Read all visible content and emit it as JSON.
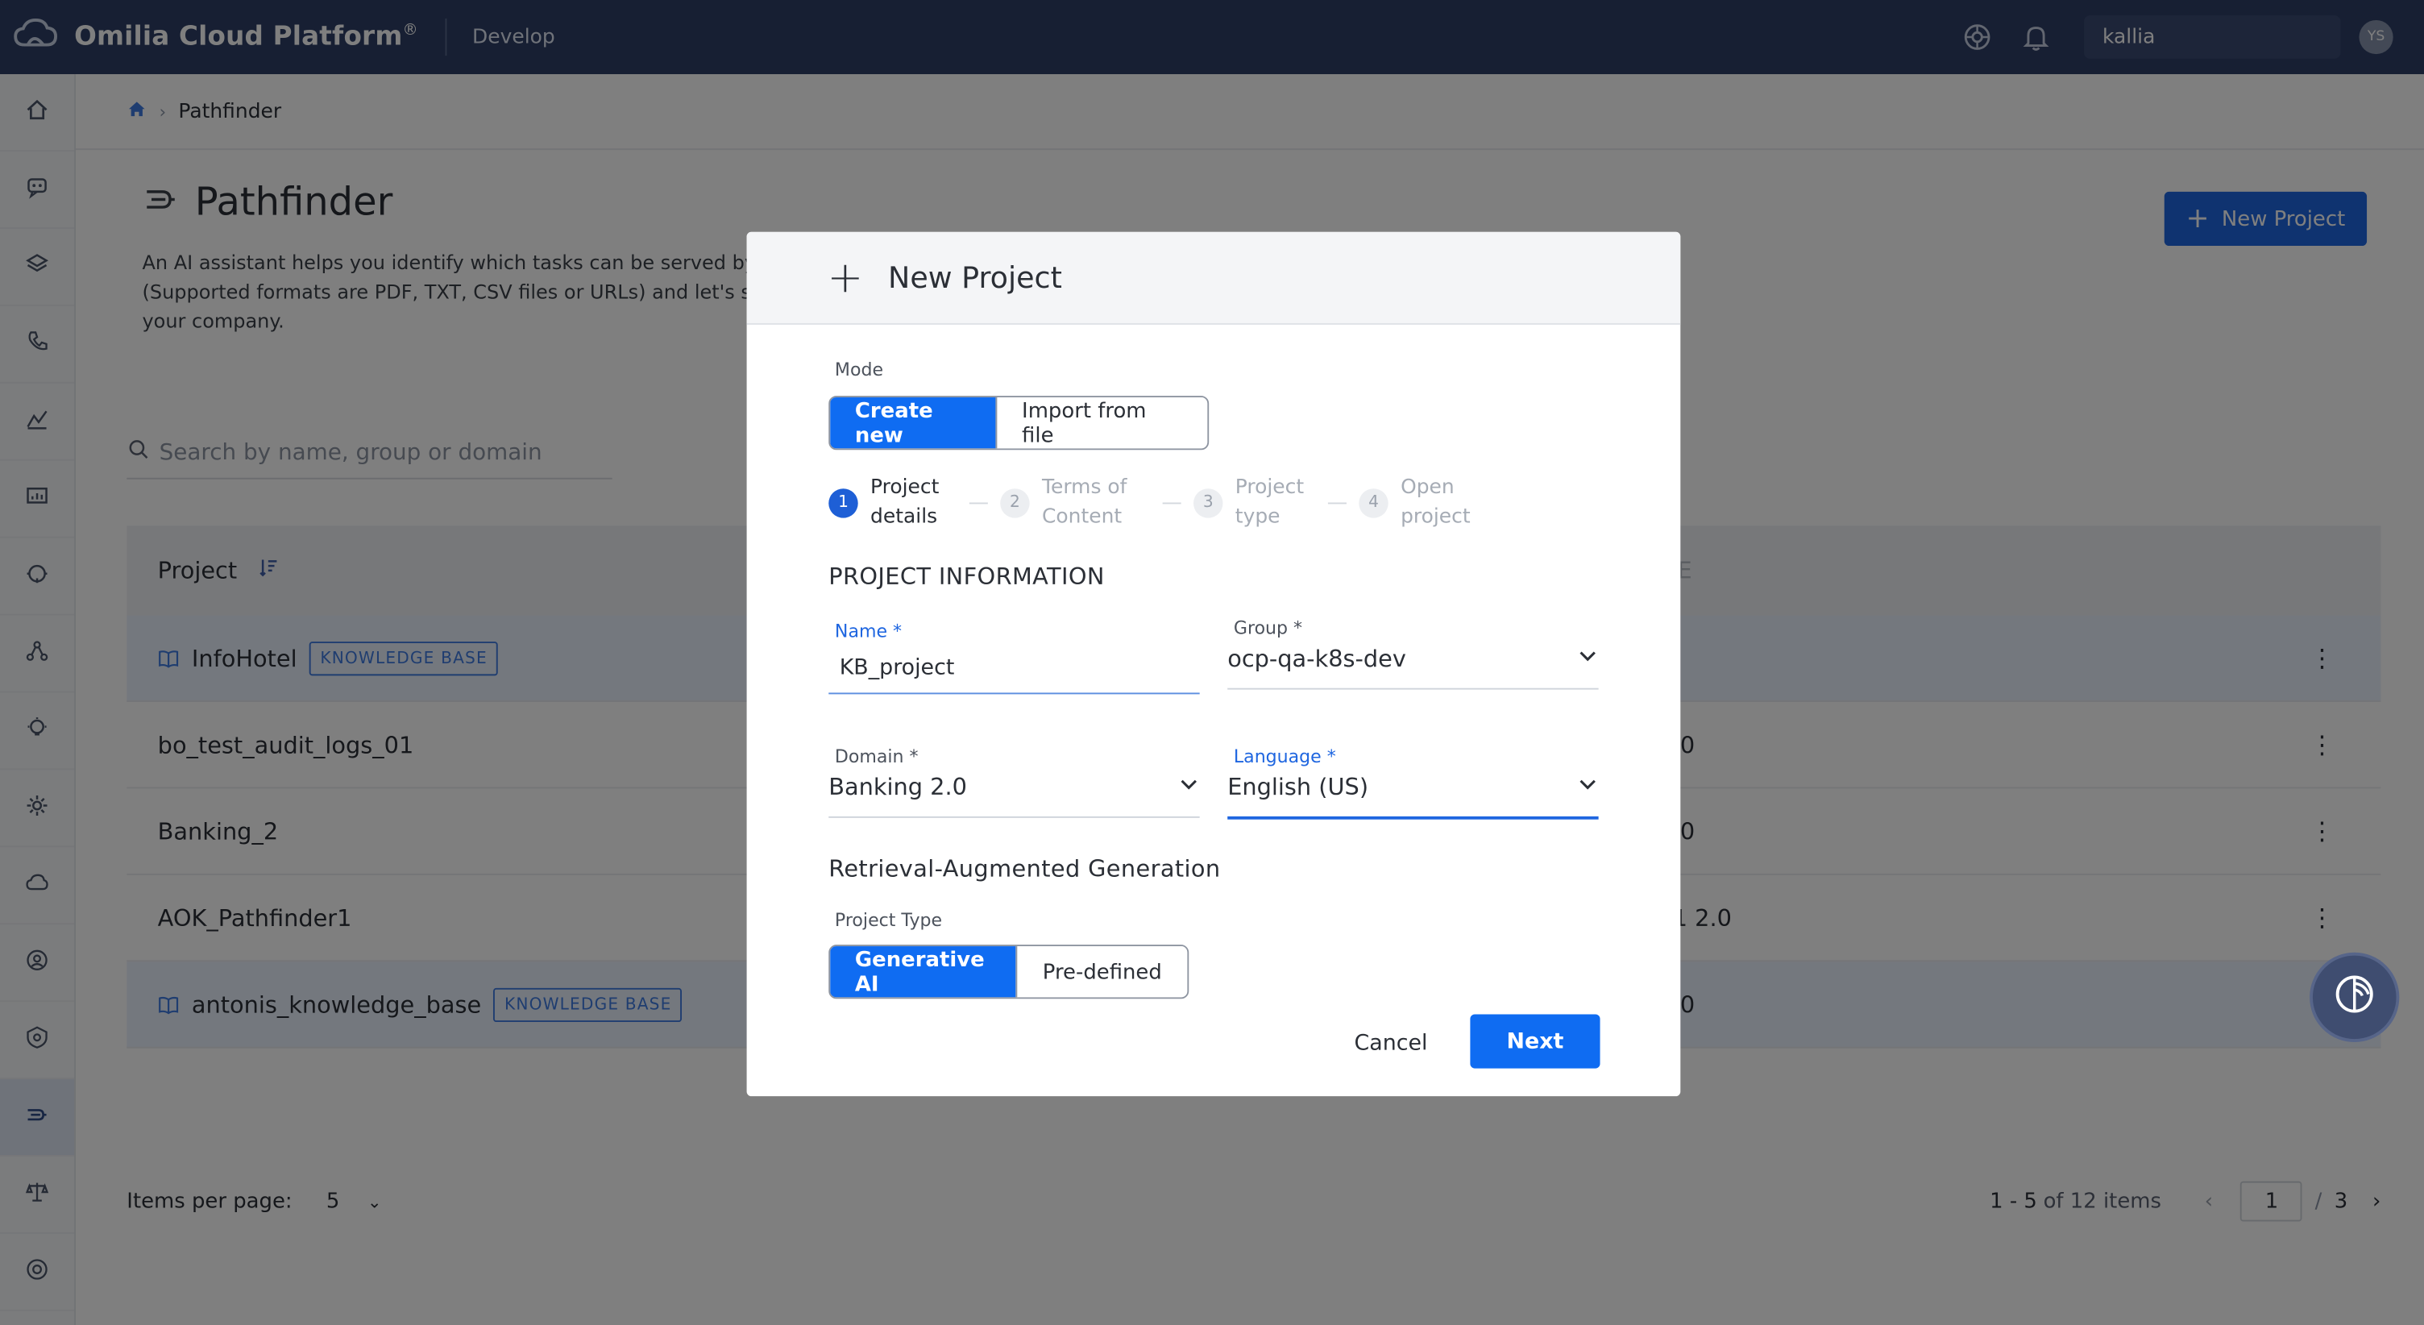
{
  "topbar": {
    "brand": "Omilia Cloud Platform",
    "brand_mark": "®",
    "environment": "Develop",
    "tenant": "kallia",
    "avatar_initials": "YS"
  },
  "sidebar": {
    "items": [
      "home-icon",
      "bots-icon",
      "layers-icon",
      "phone-icon",
      "analytics-icon",
      "monitor-icon",
      "support-icon",
      "network-icon",
      "insights-icon",
      "settings-icon",
      "cloud-icon",
      "users-icon",
      "admin-icon",
      "pathfinder-icon",
      "balance-icon",
      "help-icon"
    ],
    "active_index": 13
  },
  "breadcrumb": {
    "current": "Pathfinder"
  },
  "page": {
    "title": "Pathfinder",
    "description": "An AI assistant helps you identify which tasks can be served by\n(Supported formats are PDF, TXT, CSV files or URLs) and let's se\nyour company.",
    "new_project_label": "New Project",
    "search_placeholder": "Search by name, group or domain"
  },
  "table": {
    "header_project": "Project",
    "header_partial": "E",
    "rows": [
      {
        "name": "InfoHotel",
        "badge": "KNOWLEDGE BASE",
        "right": "-",
        "kb": true
      },
      {
        "name": "bo_test_audit_logs_01",
        "badge": "",
        "right": ".0",
        "kb": false
      },
      {
        "name": "Banking_2",
        "badge": "",
        "right": ".0",
        "kb": false
      },
      {
        "name": "AOK_Pathfinder1",
        "badge": "",
        "right": "1 2.0",
        "kb": false
      },
      {
        "name": "antonis_knowledge_base",
        "badge": "KNOWLEDGE BASE",
        "right": ".0",
        "kb": true
      }
    ]
  },
  "pager": {
    "items_per_page_label": "Items per page:",
    "items_per_page": "5",
    "range": "1 - 5",
    "of_items": "of 12 items",
    "current_page": "1",
    "total_pages": "3",
    "separator": "/"
  },
  "modal": {
    "title": "New Project",
    "mode_label": "Mode",
    "mode_options": [
      "Create new",
      "Import from file"
    ],
    "mode_selected": "Create new",
    "steps": [
      {
        "num": "1",
        "label": "Project details",
        "active": true
      },
      {
        "num": "2",
        "label": "Terms of Content",
        "active": false
      },
      {
        "num": "3",
        "label": "Project type",
        "active": false
      },
      {
        "num": "4",
        "label": "Open project",
        "active": false
      }
    ],
    "section_info": "PROJECT INFORMATION",
    "name_label": "Name *",
    "name_value": "KB_project",
    "group_label": "Group *",
    "group_value": "ocp-qa-k8s-dev",
    "domain_label": "Domain *",
    "domain_value": "Banking 2.0",
    "language_label": "Language *",
    "language_value": "English (US)",
    "section_rag": "Retrieval-Augmented Generation",
    "project_type_label": "Project Type",
    "project_type_options": [
      "Generative AI",
      "Pre-defined"
    ],
    "project_type_selected": "Generative AI",
    "cancel_label": "Cancel",
    "next_label": "Next"
  },
  "colors": {
    "primary": "#0f6cf2",
    "topbar": "#2e3f66",
    "badge": "#3f7be0"
  }
}
